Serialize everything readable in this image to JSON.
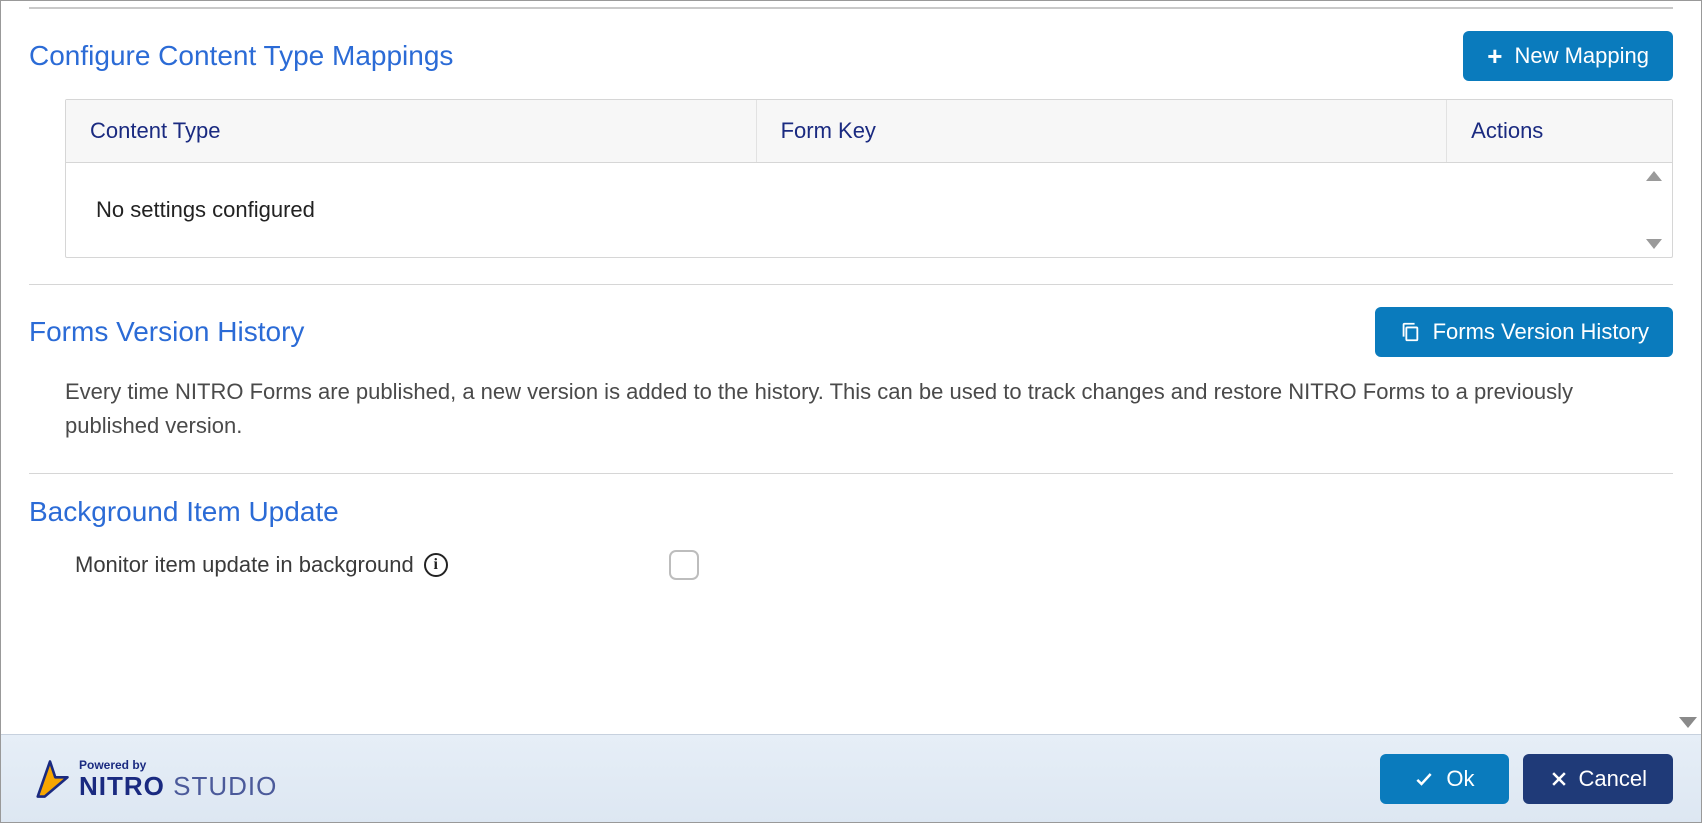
{
  "sections": {
    "mappings": {
      "title": "Configure Content Type Mappings",
      "new_button": "New Mapping",
      "columns": {
        "content_type": "Content Type",
        "form_key": "Form Key",
        "actions": "Actions"
      },
      "empty_msg": "No settings configured"
    },
    "history": {
      "title": "Forms Version History",
      "button": "Forms Version History",
      "description": "Every time NITRO Forms are published, a new version is added to the history. This can be used to track changes and restore NITRO Forms to a previously published version."
    },
    "background": {
      "title": "Background Item Update",
      "label": "Monitor item update in background",
      "checked": false
    }
  },
  "footer": {
    "powered_by": "Powered by",
    "brand": "NITRO",
    "brand_suffix": "STUDIO",
    "ok": "Ok",
    "cancel": "Cancel"
  }
}
